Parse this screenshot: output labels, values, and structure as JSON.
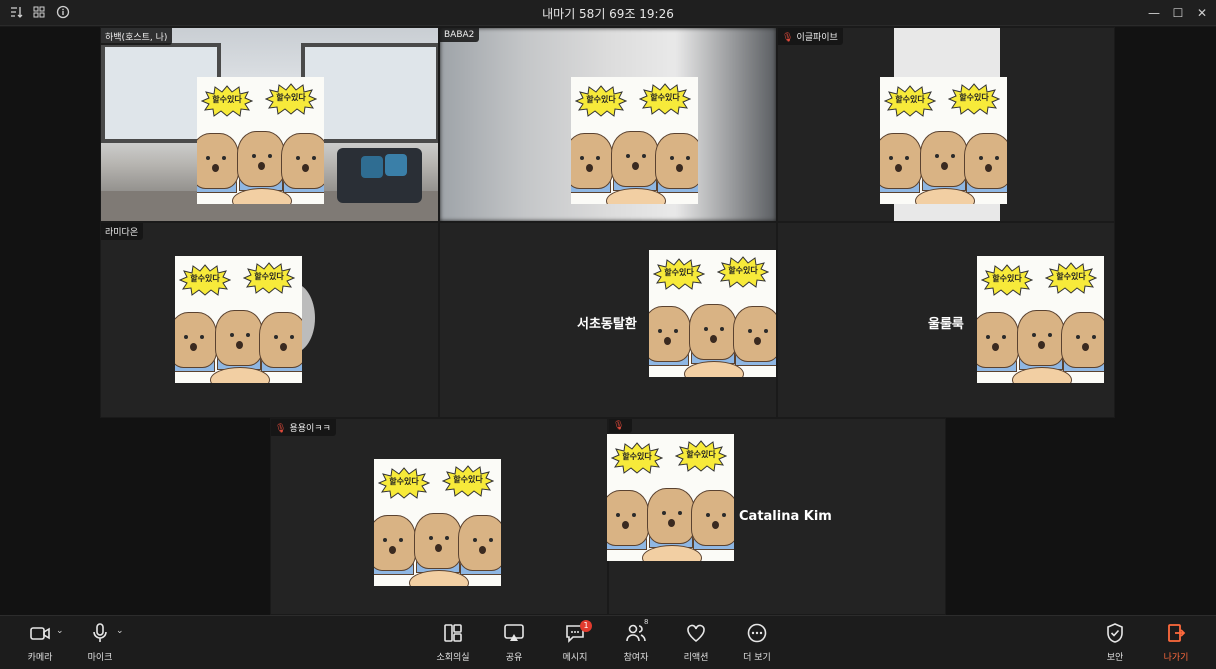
{
  "titlebar": {
    "title": "내마기 58기 69조 19:26",
    "icons": [
      "sort-icon",
      "grid-icon",
      "info-icon"
    ],
    "window_controls": [
      "minimize-icon",
      "maximize-icon",
      "close-icon"
    ]
  },
  "sticker": {
    "burst_text": "할수있다"
  },
  "participants": [
    {
      "label": "하백(호스트, 나)",
      "muted": false,
      "center_name": ""
    },
    {
      "label": "BABA2",
      "muted": false,
      "center_name": ""
    },
    {
      "label": "이글파이브",
      "muted": true,
      "center_name": ""
    },
    {
      "label": "라미다온",
      "muted": false,
      "center_name": ""
    },
    {
      "label": "",
      "muted": false,
      "center_name": "서초동탈환"
    },
    {
      "label": "",
      "muted": false,
      "center_name": "울룰룩"
    },
    {
      "label": "용용이ㅋㅋ",
      "muted": true,
      "center_name": ""
    },
    {
      "label": "",
      "muted": true,
      "center_name": "Catalina Kim"
    }
  ],
  "toolbar": {
    "camera": "카메라",
    "mic": "마이크",
    "breakout": "소회의실",
    "share": "공유",
    "messages": "메시지",
    "messages_badge": "1",
    "participants": "참여자",
    "participants_count": "8",
    "reactions": "리액션",
    "more": "더 보기",
    "security": "보안",
    "leave": "나가기"
  },
  "colors": {
    "background": "#121212",
    "tile": "#232323",
    "badge": "#e23b2e",
    "leave": "#ff6a3d",
    "muted_mic": "#e04a3b"
  }
}
